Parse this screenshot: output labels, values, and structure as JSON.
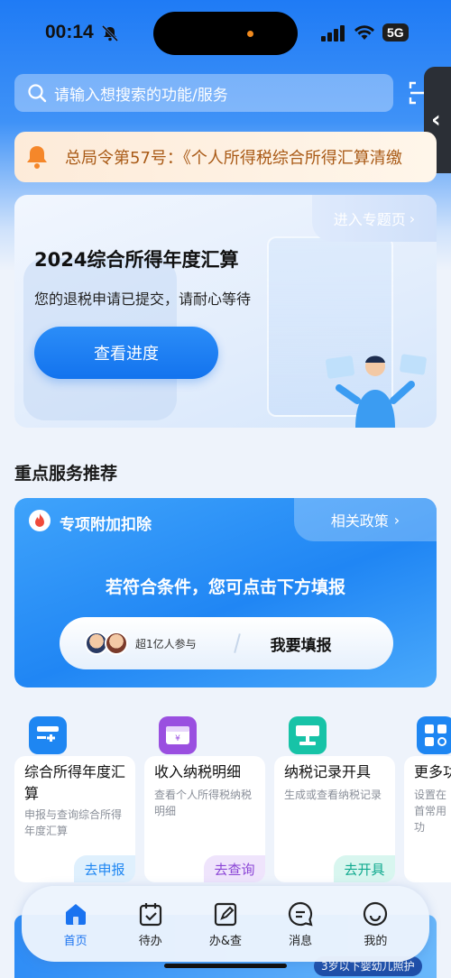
{
  "status_bar": {
    "time": "00:14",
    "network": "5G"
  },
  "search": {
    "placeholder": "请输入想搜索的功能/服务"
  },
  "notice": {
    "text": "总局令第57号：《个人所得税综合所得汇算清缴"
  },
  "hero": {
    "link": "进入专题页",
    "title": "2024综合所得年度汇算",
    "subtitle": "您的退税申请已提交，请耐心等待",
    "button": "查看进度"
  },
  "section_title": "重点服务推荐",
  "deduction": {
    "title": "专项附加扣除",
    "link": "相关政策",
    "message": "若符合条件，您可点击下方填报",
    "participants": "超1亿人参与",
    "action": "我要填报"
  },
  "services": [
    {
      "title": "综合所得年度汇算",
      "desc": "申报与查询综合所得年度汇算",
      "button": "去申报",
      "color": "#1e86f2",
      "icon": "calculator-icon"
    },
    {
      "title": "收入纳税明细",
      "desc": "查看个人所得税纳税明细",
      "button": "去查询",
      "color": "#9a4fe0",
      "icon": "wallet-icon"
    },
    {
      "title": "纳税记录开具",
      "desc": "生成或查看纳税记录",
      "button": "去开具",
      "color": "#17c3a7",
      "icon": "stamp-icon"
    },
    {
      "title": "更多功",
      "desc": "设置在首常用功",
      "button": "",
      "color": "#1e86f2",
      "icon": "grid-search-icon"
    }
  ],
  "banner": {
    "tag": "3岁以下婴幼儿照护"
  },
  "tabs": [
    {
      "label": "首页",
      "icon": "home-icon",
      "active": true
    },
    {
      "label": "待办",
      "icon": "todo-icon",
      "active": false
    },
    {
      "label": "办&查",
      "icon": "edit-doc-icon",
      "active": false
    },
    {
      "label": "消息",
      "icon": "message-icon",
      "active": false
    },
    {
      "label": "我的",
      "icon": "smile-icon",
      "active": false
    }
  ],
  "colors": {
    "primary": "#1a73f0",
    "notice_text": "#a95a16"
  }
}
